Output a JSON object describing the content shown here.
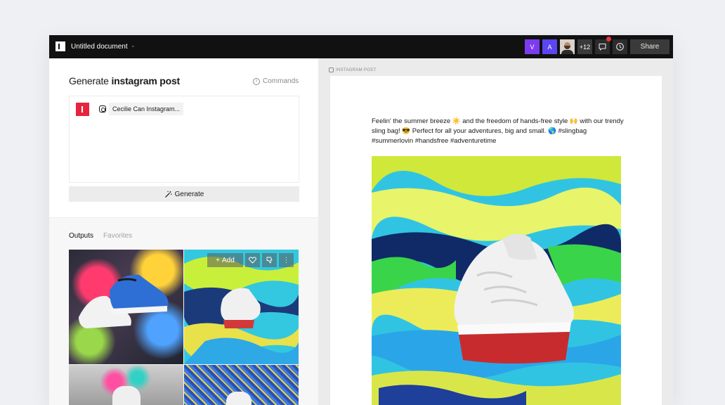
{
  "topbar": {
    "doc_title": "Untitled document",
    "avatars": [
      {
        "letter": "V",
        "color": "#7b3cf0"
      },
      {
        "letter": "A",
        "color": "#5b46f2"
      }
    ],
    "more_count": "+12",
    "share_label": "Share",
    "icons": [
      "comment-icon",
      "history-icon"
    ]
  },
  "generator": {
    "title_prefix": "Generate ",
    "title_bold": "instagram post",
    "commands_label": "Commands",
    "chip_label": "Cecilie Can Instagram...",
    "generate_label": "Generate"
  },
  "outputs": {
    "tabs": [
      "Outputs",
      "Favorites"
    ],
    "hover_actions": {
      "add_label": "Add"
    }
  },
  "preview": {
    "section_label": "INSTAGRAM POST",
    "caption": "Feelin' the summer breeze ☀️ and the freedom of hands-free style 🙌 with our trendy sling bag! 😎 Perfect for all your adventures, big and small. 🌎 #slingbag #summerlovin #handsfree #adventuretime"
  },
  "colors": {
    "brand": "#e8233f",
    "topbar_bg": "#111111",
    "notification": "#ea3437"
  }
}
